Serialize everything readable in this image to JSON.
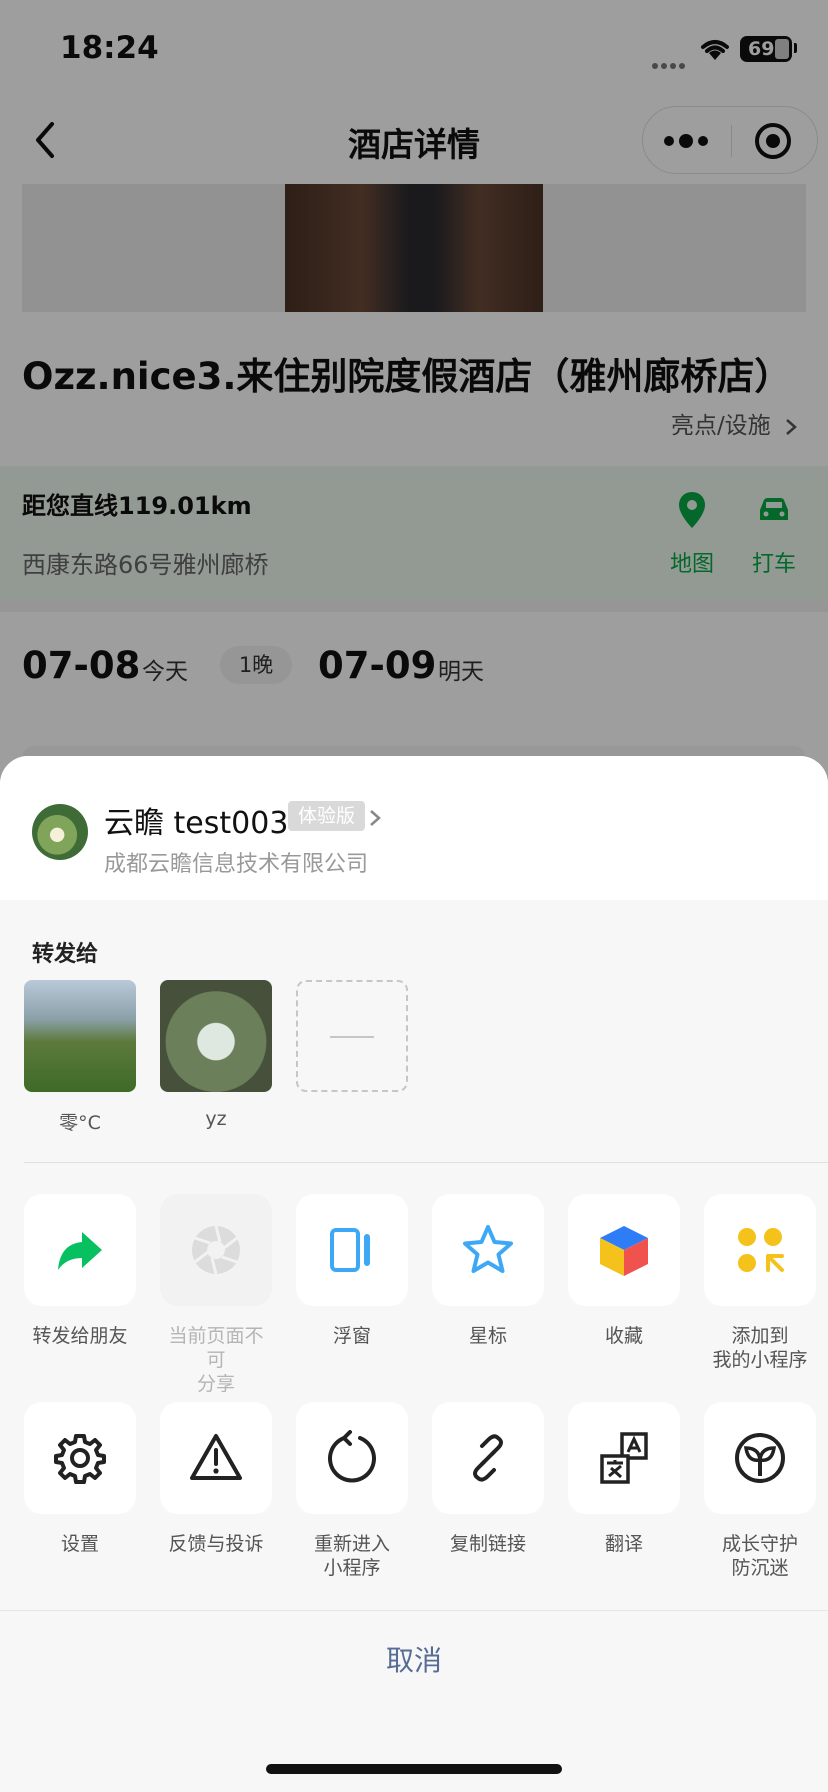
{
  "status_bar": {
    "time": "18:24",
    "battery": "69"
  },
  "nav": {
    "title": "酒店详情"
  },
  "hotel": {
    "name": "Ozz.nice3.来住别院度假酒店（雅州廊桥店）",
    "highlights": "亮点/设施",
    "distance": "距您直线119.01km",
    "address": "西康东路66号雅州廊桥",
    "map_label": "地图",
    "taxi_label": "打车",
    "checkin_date": "07-08",
    "checkin_day": "今天",
    "nights": "1晚",
    "checkout_date": "07-09",
    "checkout_day": "明天"
  },
  "sheet": {
    "app_name": "云瞻 test003",
    "app_badge": "体验版",
    "app_company": "成都云瞻信息技术有限公司",
    "forward_title": "转发给",
    "contacts": [
      {
        "name": "零°C"
      },
      {
        "name": "yz"
      }
    ],
    "actions_row1": [
      {
        "label": "转发给朋友",
        "icon": "share-arrow-icon"
      },
      {
        "label": "当前页面不可\n分享",
        "icon": "moments-shutter-icon",
        "disabled": true
      },
      {
        "label": "浮窗",
        "icon": "float-window-icon"
      },
      {
        "label": "星标",
        "icon": "star-icon"
      },
      {
        "label": "收藏",
        "icon": "favorite-cube-icon"
      },
      {
        "label": "添加到\n我的小程序",
        "icon": "add-mini-program-icon"
      }
    ],
    "actions_row2": [
      {
        "label": "设置",
        "icon": "gear-icon"
      },
      {
        "label": "反馈与投诉",
        "icon": "warning-icon"
      },
      {
        "label": "重新进入\n小程序",
        "icon": "reload-icon"
      },
      {
        "label": "复制链接",
        "icon": "link-icon"
      },
      {
        "label": "翻译",
        "icon": "translate-icon"
      },
      {
        "label": "成长守护\n防沉迷",
        "icon": "sprout-icon"
      }
    ],
    "cancel": "取消"
  },
  "colors": {
    "accent_green": "#07C160",
    "link_blue": "#576B95",
    "star_blue": "#3DA8F5",
    "collect_yellow": "#F5C21B"
  }
}
